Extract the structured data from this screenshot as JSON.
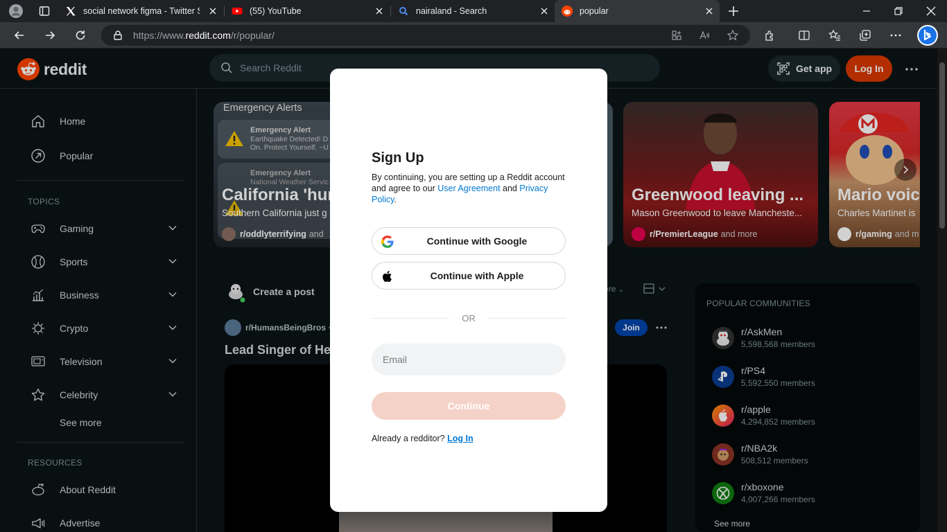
{
  "browser": {
    "tabs": [
      {
        "title": "",
        "icon": "profile-icon"
      },
      {
        "title": "social network figma - Twitter Se",
        "icon": "x-logo-icon"
      },
      {
        "title": "(55) YouTube",
        "icon": "youtube-icon"
      },
      {
        "title": "nairaland - Search",
        "icon": "search-icon"
      },
      {
        "title": "popular",
        "icon": "reddit-icon"
      }
    ],
    "url_prefix": "https://www.",
    "url_domain": "reddit.com",
    "url_path": "/r/popular/"
  },
  "header": {
    "logo_text": "reddit",
    "search_placeholder": "Search Reddit",
    "get_app_label": "Get app",
    "login_label": "Log In"
  },
  "sidebar": {
    "home": "Home",
    "popular": "Popular",
    "topics_heading": "TOPICS",
    "topics": [
      "Gaming",
      "Sports",
      "Business",
      "Crypto",
      "Television",
      "Celebrity"
    ],
    "see_more": "See more",
    "resources_heading": "RESOURCES",
    "resources": [
      "About Reddit",
      "Advertise"
    ]
  },
  "carousel": [
    {
      "title": "California 'hur",
      "subtitle": "Southern California just g",
      "subreddit": "r/oddlyterrifying",
      "more": "and",
      "overlay_heading": "Emergency Alerts",
      "alert1_title": "Emergency Alert",
      "alert1_body1": "Earthquake Detected! D",
      "alert1_body2": "On. Protect Yourself. ~U",
      "alert2_title": "Emergency Alert",
      "alert2_body1": "National Weather Servic"
    },
    {
      "title": "Greenwood leaving ...",
      "subtitle": "Mason Greenwood to leave Mancheste...",
      "subreddit": "r/PremierLeague",
      "more": "and more"
    },
    {
      "title": "Mario voic",
      "subtitle": "Charles Martinet is",
      "subreddit": "r/gaming",
      "more": "and m"
    }
  ],
  "feed": {
    "create_post": "Create a post",
    "sort_partial": "ere",
    "post_subreddit": "r/HumansBeingBros",
    "post_dot": "•",
    "post_title": "Lead Singer of Hea",
    "join_label": "Join"
  },
  "popular_communities": {
    "heading": "POPULAR COMMUNITIES",
    "items": [
      {
        "name": "r/AskMen",
        "members": "5,598,568 members",
        "color": "#e8e8e8"
      },
      {
        "name": "r/PS4",
        "members": "5,592,550 members",
        "color": "#0b3d91"
      },
      {
        "name": "r/apple",
        "members": "4,294,852 members",
        "color": "#ff5722"
      },
      {
        "name": "r/NBA2k",
        "members": "508,512 members",
        "color": "#8a3324"
      },
      {
        "name": "r/xboxone",
        "members": "4,007,266 members",
        "color": "#107c10"
      }
    ],
    "see_more": "See more"
  },
  "modal": {
    "title": "Sign Up",
    "text_prefix": "By continuing, you are setting up a Reddit account and agree to our ",
    "user_agreement": "User Agreement",
    "text_and": " and ",
    "privacy_policy": "Privacy Policy",
    "text_end": ".",
    "google_label": "Continue with Google",
    "apple_label": "Continue with Apple",
    "or_label": "OR",
    "email_placeholder": "Email",
    "continue_label": "Continue",
    "already_text": "Already a redditor? ",
    "login_link": "Log In"
  },
  "colors": {
    "accent": "#d93900",
    "link": "#0079d3",
    "join": "#0045ac",
    "background": "#0b1416"
  }
}
